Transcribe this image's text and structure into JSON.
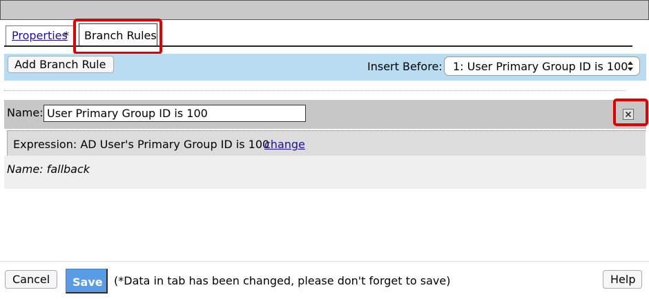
{
  "tabs": {
    "properties_label": "Properties",
    "properties_modified_marker": "*",
    "branch_rules_label": "Branch Rules"
  },
  "toolbar": {
    "add_label": "Add Branch Rule",
    "insert_before_label": "Insert Before:",
    "insert_before_value": "1: User Primary Group ID is 100"
  },
  "rule": {
    "name_label": "Name:",
    "name_value": "User Primary Group ID is 100",
    "expression_text": "Expression: AD User's Primary Group ID is 100",
    "change_link": "change"
  },
  "fallback": {
    "name_text": "Name: fallback"
  },
  "footer": {
    "cancel_label": "Cancel",
    "save_label": "Save",
    "save_note": "(*Data in tab has been changed, please don't forget to save)",
    "help_label": "Help"
  },
  "colors": {
    "toolbar_bg": "#b9dcf1",
    "save_bg": "#5a9be5",
    "highlight": "#e00000",
    "link": "#1a0dab"
  }
}
